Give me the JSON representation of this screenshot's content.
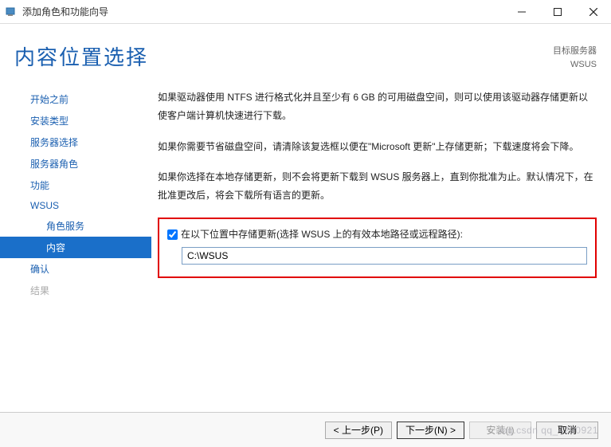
{
  "window": {
    "title": "添加角色和功能向导"
  },
  "header": {
    "page_title": "内容位置选择",
    "target_label": "目标服务器",
    "target_value": "WSUS"
  },
  "sidebar": {
    "items": [
      {
        "label": "开始之前"
      },
      {
        "label": "安装类型"
      },
      {
        "label": "服务器选择"
      },
      {
        "label": "服务器角色"
      },
      {
        "label": "功能"
      },
      {
        "label": "WSUS"
      },
      {
        "label": "角色服务"
      },
      {
        "label": "内容"
      },
      {
        "label": "确认"
      },
      {
        "label": "结果"
      }
    ]
  },
  "body": {
    "para1": "如果驱动器使用 NTFS 进行格式化并且至少有 6 GB 的可用磁盘空间，则可以使用该驱动器存储更新以使客户端计算机快速进行下载。",
    "para2": "如果你需要节省磁盘空间，请清除该复选框以便在\"Microsoft 更新\"上存储更新；下载速度将会下降。",
    "para3": "如果你选择在本地存储更新，则不会将更新下载到 WSUS 服务器上，直到你批准为止。默认情况下，在批准更改后，将会下载所有语言的更新。",
    "checkbox_label": "在以下位置中存储更新(选择 WSUS 上的有效本地路径或远程路径):",
    "path_value": "C:\\WSUS"
  },
  "footer": {
    "prev": "< 上一步(P)",
    "next": "下一步(N) >",
    "install": "安装(I)",
    "cancel": "取消"
  },
  "watermark": "log.csdn qq_4290921"
}
